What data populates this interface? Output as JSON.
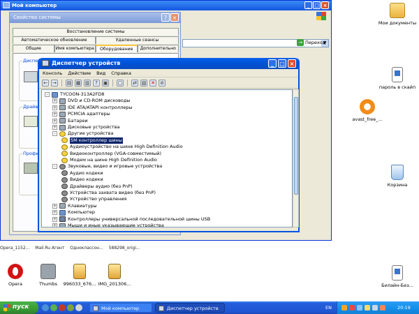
{
  "explorer": {
    "title": "Мой компьютер",
    "go_label": "Переход"
  },
  "system_properties": {
    "title": "Свойства системы",
    "tabs_row1": [
      "Восстановление системы"
    ],
    "tabs_row2": [
      "Автоматическое обновление",
      "Удаленные сеансы"
    ],
    "tabs_row3": [
      "Общие",
      "Имя компьютера",
      "Оборудование",
      "Дополнительно"
    ],
    "active_tab": "Оборудование",
    "frames": [
      "Диспет",
      "Драйве",
      "Профи"
    ]
  },
  "device_manager": {
    "title": "Диспетчер устройств",
    "menu": [
      "Консоль",
      "Действие",
      "Вид",
      "Справка"
    ],
    "tree": [
      {
        "level": 0,
        "expander": "-",
        "icon": "computer-icon",
        "label": "TYCOON-313A2FD8"
      },
      {
        "level": 1,
        "expander": "+",
        "icon": "dvd-drive-icon",
        "label": "DVD и CD-ROM дисководы"
      },
      {
        "level": 1,
        "expander": "+",
        "icon": "ide-controller-icon",
        "label": "IDE ATA/ATAPI контроллеры"
      },
      {
        "level": 1,
        "expander": "+",
        "icon": "pcmcia-icon",
        "label": "PCMCIA адаптеры"
      },
      {
        "level": 1,
        "expander": "+",
        "icon": "battery-icon",
        "label": "Батареи"
      },
      {
        "level": 1,
        "expander": "+",
        "icon": "disk-drive-icon",
        "label": "Дисковые устройства"
      },
      {
        "level": 1,
        "expander": "-",
        "icon": "unknown-device-icon",
        "label": "Другие устройства"
      },
      {
        "level": 2,
        "expander": "",
        "icon": "unknown-device-icon",
        "label": "SM контроллер шины",
        "selected": true
      },
      {
        "level": 2,
        "expander": "",
        "icon": "unknown-device-icon",
        "label": "Аудиоустройство на шине High Definition Audio"
      },
      {
        "level": 2,
        "expander": "",
        "icon": "unknown-device-icon",
        "label": "Видеоконтроллер (VGA-совместимый)"
      },
      {
        "level": 2,
        "expander": "",
        "icon": "unknown-device-icon",
        "label": "Модем на шине High Definition Audio"
      },
      {
        "level": 1,
        "expander": "-",
        "icon": "sound-icon",
        "label": "Звуковые, видео и игровые устройства"
      },
      {
        "level": 2,
        "expander": "",
        "icon": "sound-icon",
        "label": "Аудио кодеки"
      },
      {
        "level": 2,
        "expander": "",
        "icon": "sound-icon",
        "label": "Видео кодеки"
      },
      {
        "level": 2,
        "expander": "",
        "icon": "sound-icon",
        "label": "Драйверы аудио (без PnP)"
      },
      {
        "level": 2,
        "expander": "",
        "icon": "sound-icon",
        "label": "Устройства захвата видео (без PnP)"
      },
      {
        "level": 2,
        "expander": "",
        "icon": "sound-icon",
        "label": "Устройство управления"
      },
      {
        "level": 1,
        "expander": "+",
        "icon": "keyboard-icon",
        "label": "Клавиатуры"
      },
      {
        "level": 1,
        "expander": "+",
        "icon": "computer-icon",
        "label": "Компьютер"
      },
      {
        "level": 1,
        "expander": "+",
        "icon": "usb-icon",
        "label": "Контроллеры универсальной последовательной шины USB"
      },
      {
        "level": 1,
        "expander": "+",
        "icon": "mouse-icon",
        "label": "Мыши и иные указывающие устройства"
      }
    ]
  },
  "desktop_icons": [
    {
      "label": "Мои документы",
      "icon": "my-documents-icon"
    },
    {
      "label": "пароль в скайп",
      "icon": "text-document-icon"
    },
    {
      "label": "avast_free_...",
      "icon": "avast-icon"
    },
    {
      "label": "Корзина",
      "icon": "recycle-bin-icon"
    },
    {
      "label": "Opera",
      "icon": "opera-icon"
    },
    {
      "label": "Thumbs",
      "icon": "thumbs-file-icon"
    },
    {
      "label": "996033_676...",
      "icon": "image-file-icon"
    },
    {
      "label": "IMG_201306...",
      "icon": "image-file-icon"
    },
    {
      "label": "Билайн-Без...",
      "icon": "text-document-icon"
    }
  ],
  "desktop_strip": [
    "Opera_1152...",
    "Mail.Ru Агент",
    "Одноклассон...",
    "588298_origi..."
  ],
  "taskbar": {
    "start_label": "пуск",
    "tasks": [
      "Мой компьютер",
      "Диспетчер устройств"
    ],
    "active_task": "Диспетчер устройств",
    "language": "EN",
    "clock": "20:19"
  }
}
